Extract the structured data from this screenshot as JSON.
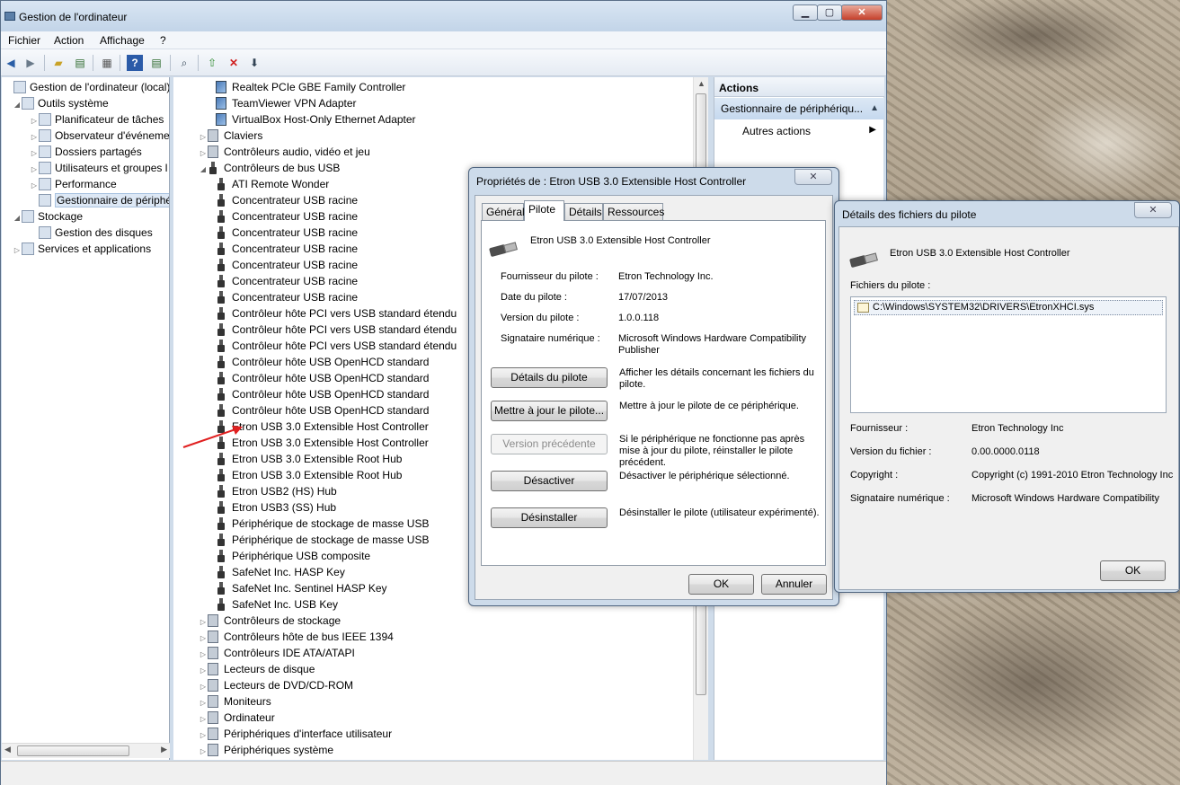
{
  "window": {
    "title": "Gestion de l'ordinateur",
    "minimize": "▁",
    "maximize": "▢",
    "close": "✕"
  },
  "menu": [
    "Fichier",
    "Action",
    "Affichage",
    "?"
  ],
  "toolbar_icons": [
    "back-arrow-icon",
    "forward-arrow-icon",
    "up-folder-icon",
    "show-hide-tree-icon",
    "properties-icon",
    "help-icon",
    "show-hide-action-icon",
    "scan-hardware-icon",
    "update-driver-icon",
    "uninstall-icon",
    "disable-icon"
  ],
  "left_tree": [
    {
      "label": "Gestion de l'ordinateur (local)",
      "level": 0,
      "arrow": "",
      "icon": "computer-management-icon"
    },
    {
      "label": "Outils système",
      "level": 1,
      "arrow": "◢",
      "icon": "system-tools-icon"
    },
    {
      "label": "Planificateur de tâches",
      "level": 2,
      "arrow": "▷",
      "icon": "task-scheduler-icon"
    },
    {
      "label": "Observateur d'événements",
      "level": 2,
      "arrow": "▷",
      "icon": "event-viewer-icon"
    },
    {
      "label": "Dossiers partagés",
      "level": 2,
      "arrow": "▷",
      "icon": "shared-folders-icon"
    },
    {
      "label": "Utilisateurs et groupes l",
      "level": 2,
      "arrow": "▷",
      "icon": "users-groups-icon"
    },
    {
      "label": "Performance",
      "level": 2,
      "arrow": "▷",
      "icon": "performance-icon"
    },
    {
      "label": "Gestionnaire de périphé",
      "level": 2,
      "arrow": "",
      "icon": "device-manager-icon",
      "selected": true
    },
    {
      "label": "Stockage",
      "level": 1,
      "arrow": "◢",
      "icon": "storage-icon"
    },
    {
      "label": "Gestion des disques",
      "level": 2,
      "arrow": "",
      "icon": "disk-management-icon"
    },
    {
      "label": "Services et applications",
      "level": 1,
      "arrow": "▷",
      "icon": "services-icon"
    }
  ],
  "device_tree": [
    {
      "label": "Realtek PCIe GBE Family Controller",
      "level": 2,
      "icon": "network-adapter-icon"
    },
    {
      "label": "TeamViewer VPN Adapter",
      "level": 2,
      "icon": "network-adapter-icon"
    },
    {
      "label": "VirtualBox Host-Only Ethernet Adapter",
      "level": 2,
      "icon": "network-adapter-icon"
    },
    {
      "label": "Claviers",
      "level": 1,
      "arrow": "▷",
      "icon": "keyboard-icon"
    },
    {
      "label": "Contrôleurs audio, vidéo et jeu",
      "level": 1,
      "arrow": "▷",
      "icon": "audio-icon"
    },
    {
      "label": "Contrôleurs de bus USB",
      "level": 1,
      "arrow": "◢",
      "icon": "usb-icon"
    },
    {
      "label": "ATI Remote Wonder",
      "level": 2,
      "icon": "usb-icon"
    },
    {
      "label": "Concentrateur USB racine",
      "level": 2,
      "icon": "usb-icon"
    },
    {
      "label": "Concentrateur USB racine",
      "level": 2,
      "icon": "usb-icon"
    },
    {
      "label": "Concentrateur USB racine",
      "level": 2,
      "icon": "usb-icon"
    },
    {
      "label": "Concentrateur USB racine",
      "level": 2,
      "icon": "usb-icon"
    },
    {
      "label": "Concentrateur USB racine",
      "level": 2,
      "icon": "usb-icon"
    },
    {
      "label": "Concentrateur USB racine",
      "level": 2,
      "icon": "usb-icon"
    },
    {
      "label": "Concentrateur USB racine",
      "level": 2,
      "icon": "usb-icon"
    },
    {
      "label": "Contrôleur hôte PCI vers USB standard étendu",
      "level": 2,
      "icon": "usb-icon"
    },
    {
      "label": "Contrôleur hôte PCI vers USB standard étendu",
      "level": 2,
      "icon": "usb-icon"
    },
    {
      "label": "Contrôleur hôte PCI vers USB standard étendu",
      "level": 2,
      "icon": "usb-icon"
    },
    {
      "label": "Contrôleur hôte USB OpenHCD standard",
      "level": 2,
      "icon": "usb-icon"
    },
    {
      "label": "Contrôleur hôte USB OpenHCD standard",
      "level": 2,
      "icon": "usb-icon"
    },
    {
      "label": "Contrôleur hôte USB OpenHCD standard",
      "level": 2,
      "icon": "usb-icon"
    },
    {
      "label": "Contrôleur hôte USB OpenHCD standard",
      "level": 2,
      "icon": "usb-icon"
    },
    {
      "label": "Etron USB 3.0 Extensible Host Controller",
      "level": 2,
      "icon": "usb-icon"
    },
    {
      "label": "Etron USB 3.0 Extensible Host Controller",
      "level": 2,
      "icon": "usb-icon"
    },
    {
      "label": "Etron USB 3.0 Extensible Root Hub",
      "level": 2,
      "icon": "usb-icon"
    },
    {
      "label": "Etron USB 3.0 Extensible Root Hub",
      "level": 2,
      "icon": "usb-icon"
    },
    {
      "label": "Etron USB2 (HS) Hub",
      "level": 2,
      "icon": "usb-icon"
    },
    {
      "label": "Etron USB3 (SS) Hub",
      "level": 2,
      "icon": "usb-icon"
    },
    {
      "label": "Périphérique de stockage de masse USB",
      "level": 2,
      "icon": "usb-icon"
    },
    {
      "label": "Périphérique de stockage de masse USB",
      "level": 2,
      "icon": "usb-icon"
    },
    {
      "label": "Périphérique USB composite",
      "level": 2,
      "icon": "usb-icon"
    },
    {
      "label": "SafeNet Inc. HASP Key",
      "level": 2,
      "icon": "usb-icon"
    },
    {
      "label": "SafeNet Inc. Sentinel HASP Key",
      "level": 2,
      "icon": "usb-icon"
    },
    {
      "label": "SafeNet Inc. USB Key",
      "level": 2,
      "icon": "usb-icon"
    },
    {
      "label": "Contrôleurs de stockage",
      "level": 1,
      "arrow": "▷",
      "icon": "storage-controller-icon"
    },
    {
      "label": "Contrôleurs hôte de bus IEEE 1394",
      "level": 1,
      "arrow": "▷",
      "icon": "ieee1394-icon"
    },
    {
      "label": "Contrôleurs IDE ATA/ATAPI",
      "level": 1,
      "arrow": "▷",
      "icon": "ide-icon"
    },
    {
      "label": "Lecteurs de disque",
      "level": 1,
      "arrow": "▷",
      "icon": "disk-drive-icon"
    },
    {
      "label": "Lecteurs de DVD/CD-ROM",
      "level": 1,
      "arrow": "▷",
      "icon": "dvd-icon"
    },
    {
      "label": "Moniteurs",
      "level": 1,
      "arrow": "▷",
      "icon": "monitor-icon"
    },
    {
      "label": "Ordinateur",
      "level": 1,
      "arrow": "▷",
      "icon": "computer-icon"
    },
    {
      "label": "Périphériques d'interface utilisateur",
      "level": 1,
      "arrow": "▷",
      "icon": "hid-icon"
    },
    {
      "label": "Périphériques système",
      "level": 1,
      "arrow": "▷",
      "icon": "system-devices-icon"
    }
  ],
  "actions": {
    "header": "Actions",
    "section": "Gestionnaire de périphériqu...",
    "more": "Autres actions"
  },
  "properties_dialog": {
    "title": "Propriétés de : Etron USB 3.0 Extensible Host Controller",
    "close": "✕",
    "tabs": [
      "Général",
      "Pilote",
      "Détails",
      "Ressources"
    ],
    "active_tab": "Pilote",
    "device_name": "Etron USB 3.0 Extensible Host Controller",
    "fields": [
      {
        "label": "Fournisseur du pilote :",
        "value": "Etron Technology Inc."
      },
      {
        "label": "Date du pilote :",
        "value": "17/07/2013"
      },
      {
        "label": "Version du pilote :",
        "value": "1.0.0.118"
      },
      {
        "label": "Signataire numérique :",
        "value": "Microsoft Windows Hardware Compatibility Publisher"
      }
    ],
    "buttons": [
      {
        "label": "Détails du pilote",
        "desc": "Afficher les détails concernant les fichiers du pilote.",
        "disabled": false
      },
      {
        "label": "Mettre à jour le pilote...",
        "desc": "Mettre à jour le pilote de ce périphérique.",
        "disabled": false
      },
      {
        "label": "Version précédente",
        "desc": "Si le périphérique ne fonctionne pas après mise à jour du pilote, réinstaller le pilote précédent.",
        "disabled": true
      },
      {
        "label": "Désactiver",
        "desc": "Désactiver le périphérique sélectionné.",
        "disabled": false
      },
      {
        "label": "Désinstaller",
        "desc": "Désinstaller le pilote (utilisateur expérimenté).",
        "disabled": false
      }
    ],
    "ok": "OK",
    "cancel": "Annuler"
  },
  "details_dialog": {
    "title": "Détails des fichiers du pilote",
    "close": "✕",
    "device_name": "Etron USB 3.0 Extensible Host Controller",
    "files_label": "Fichiers du pilote :",
    "file": "C:\\Windows\\SYSTEM32\\DRIVERS\\EtronXHCI.sys",
    "fields": [
      {
        "label": "Fournisseur :",
        "value": "Etron Technology Inc"
      },
      {
        "label": "Version du fichier :",
        "value": "0.00.0000.0118"
      },
      {
        "label": "Copyright :",
        "value": "Copyright (c) 1991-2010 Etron Technology Inc"
      },
      {
        "label": "Signataire numérique :",
        "value": "Microsoft Windows Hardware Compatibility"
      }
    ],
    "ok": "OK"
  },
  "colors": {
    "annotation_arrow": "#e02020",
    "selection": "#dde8f5",
    "window_frame": "#cfdcea"
  }
}
